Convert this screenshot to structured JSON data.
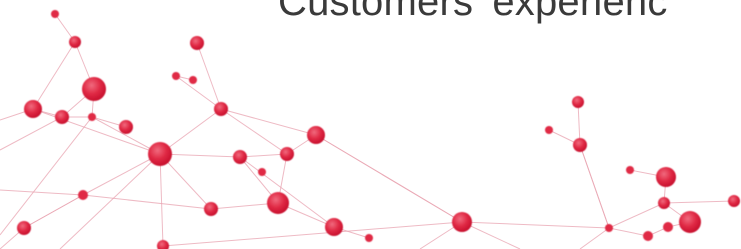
{
  "heading": {
    "text": "Customers' experienc"
  },
  "graphic": {
    "icon": "molecular-network-illustration",
    "node_color": "#e02a45",
    "edge_color": "#e8a3b0"
  }
}
